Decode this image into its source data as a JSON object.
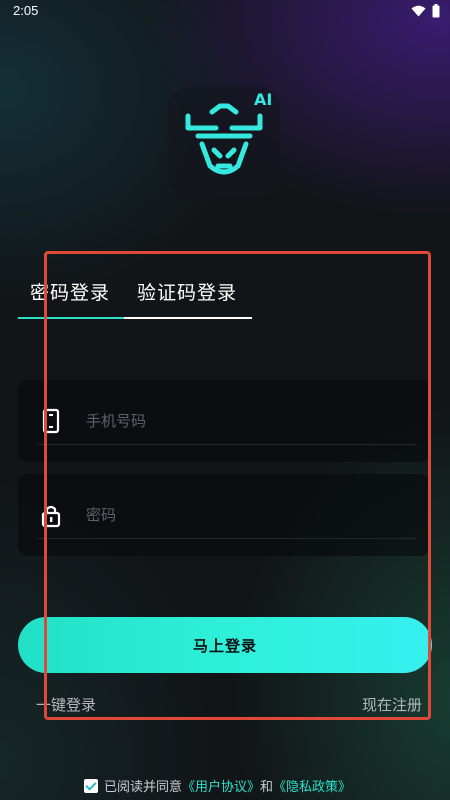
{
  "status_bar": {
    "time": "2:05",
    "icons": [
      "wifi-icon",
      "battery-icon"
    ]
  },
  "logo": {
    "icon": "bull-head-icon",
    "badge_text": "AI",
    "accent_color": "#35e8e0"
  },
  "tabs": [
    {
      "label": "密码登录",
      "active": true
    },
    {
      "label": "验证码登录",
      "active": false
    }
  ],
  "form": {
    "phone_placeholder": "手机号码",
    "phone_value": "",
    "password_placeholder": "密码",
    "password_value": "",
    "phone_icon": "phone-icon",
    "password_icon": "lock-icon"
  },
  "actions": {
    "login_label": "马上登录",
    "one_key_login": "一键登录",
    "register_now": "现在注册"
  },
  "agreement": {
    "checked": true,
    "prefix": "已阅读并同意",
    "user_agreement": "《用户协议》",
    "conjunction": "和",
    "privacy_policy": "《隐私政策》"
  },
  "colors": {
    "accent": "#2de0c8",
    "button_gradient_start": "#22e0c6",
    "button_gradient_end": "#36f0f0",
    "highlight_box": "#e0493a"
  }
}
